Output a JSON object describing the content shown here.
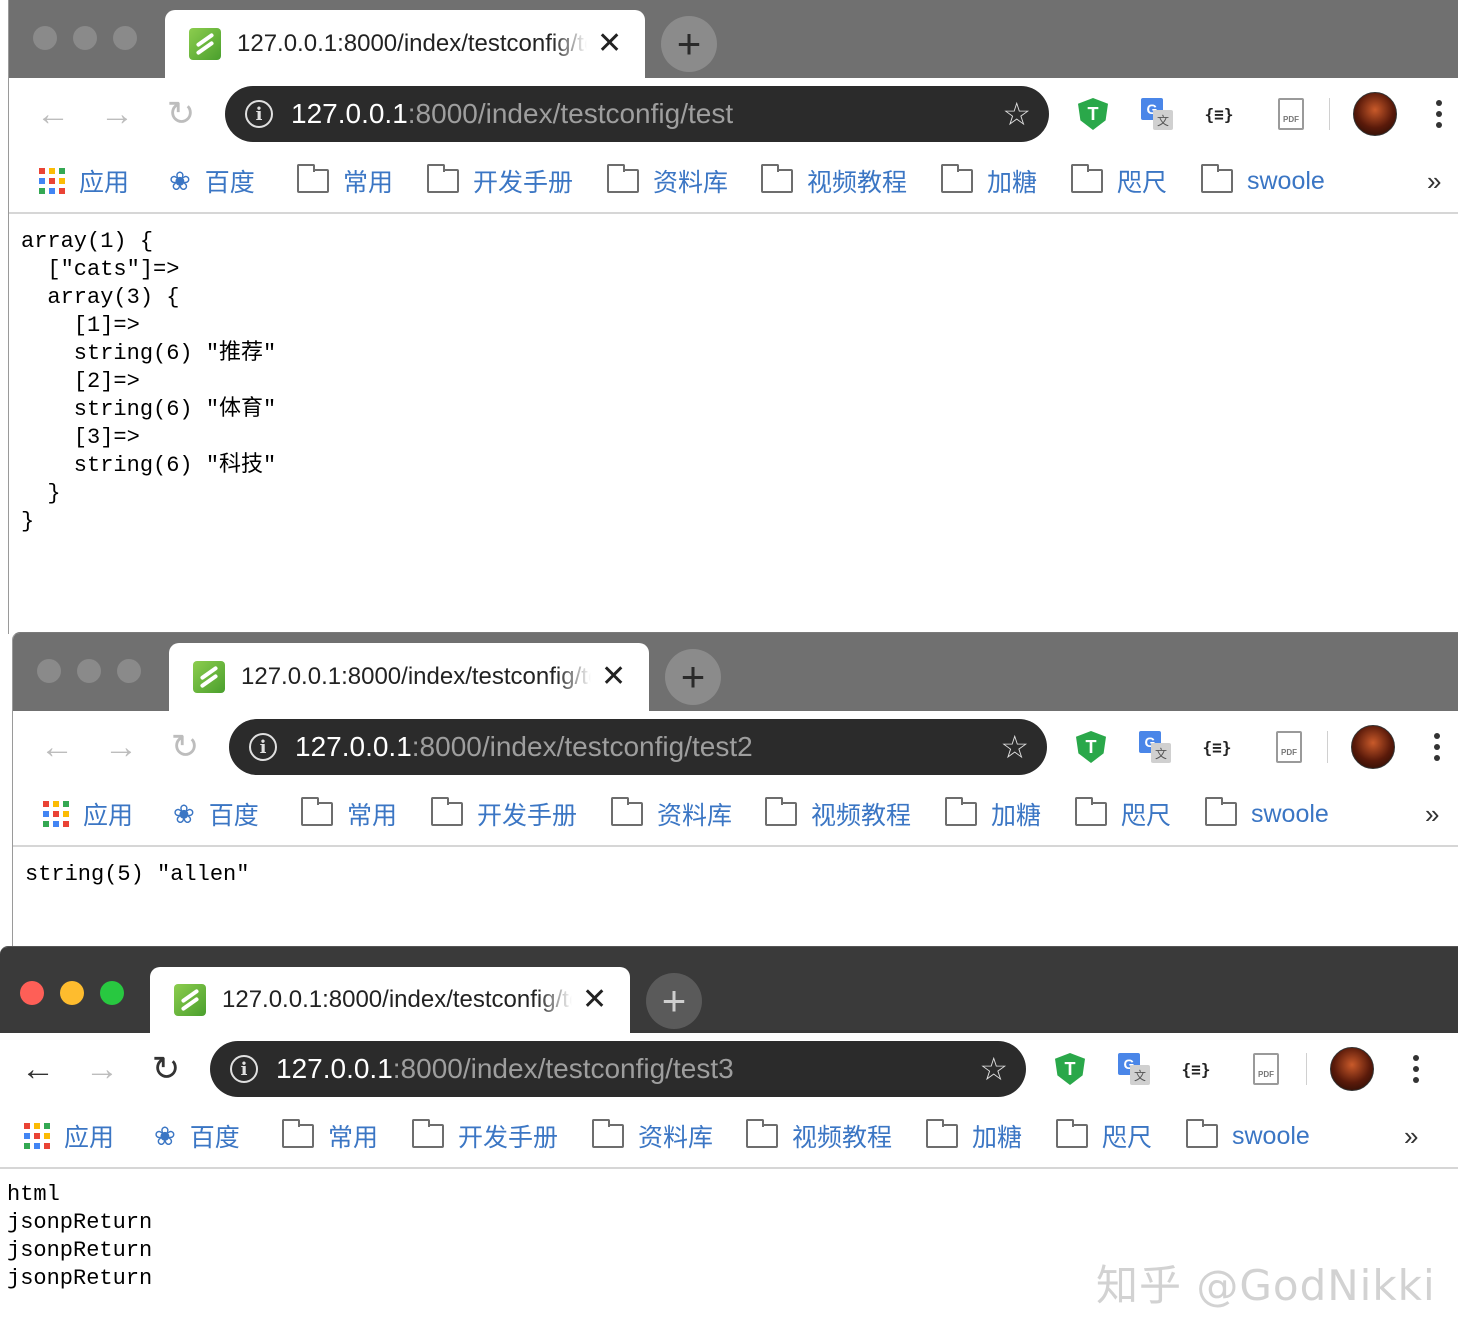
{
  "tab_title": "127.0.0.1:8000/index/testconfig/test",
  "new_tab_symbol": "+",
  "close_symbol": "✕",
  "url_host": "127.0.0.1",
  "star_symbol": "☆",
  "ext_json_label": "{≡}",
  "ext_pdf_label": "PDF",
  "bookmarks": [
    "应用",
    "百度",
    "常用",
    "开发手册",
    "资料库",
    "视频教程",
    "加糖",
    "咫尺",
    "swoole"
  ],
  "more_symbol": "»",
  "windows": [
    {
      "url_path": ":8000/index/testconfig/test",
      "content": "array(1) {\n  [\"cats\"]=>\n  array(3) {\n    [1]=>\n    string(6) \"推荐\"\n    [2]=>\n    string(6) \"体育\"\n    [3]=>\n    string(6) \"科技\"\n  }\n}"
    },
    {
      "url_path": ":8000/index/testconfig/test2",
      "content": "string(5) \"allen\""
    },
    {
      "url_path": ":8000/index/testconfig/test3",
      "content": "html\njsonpReturn\njsonpReturn\njsonpReturn"
    }
  ],
  "watermark": "知乎 @GodNikki",
  "colors": {
    "bookmark_text": "#3b76c4",
    "omnibox_bg": "#2b2b2b",
    "traffic_red": "#fe5f57",
    "traffic_yellow": "#febc2e",
    "traffic_green": "#28c840"
  }
}
